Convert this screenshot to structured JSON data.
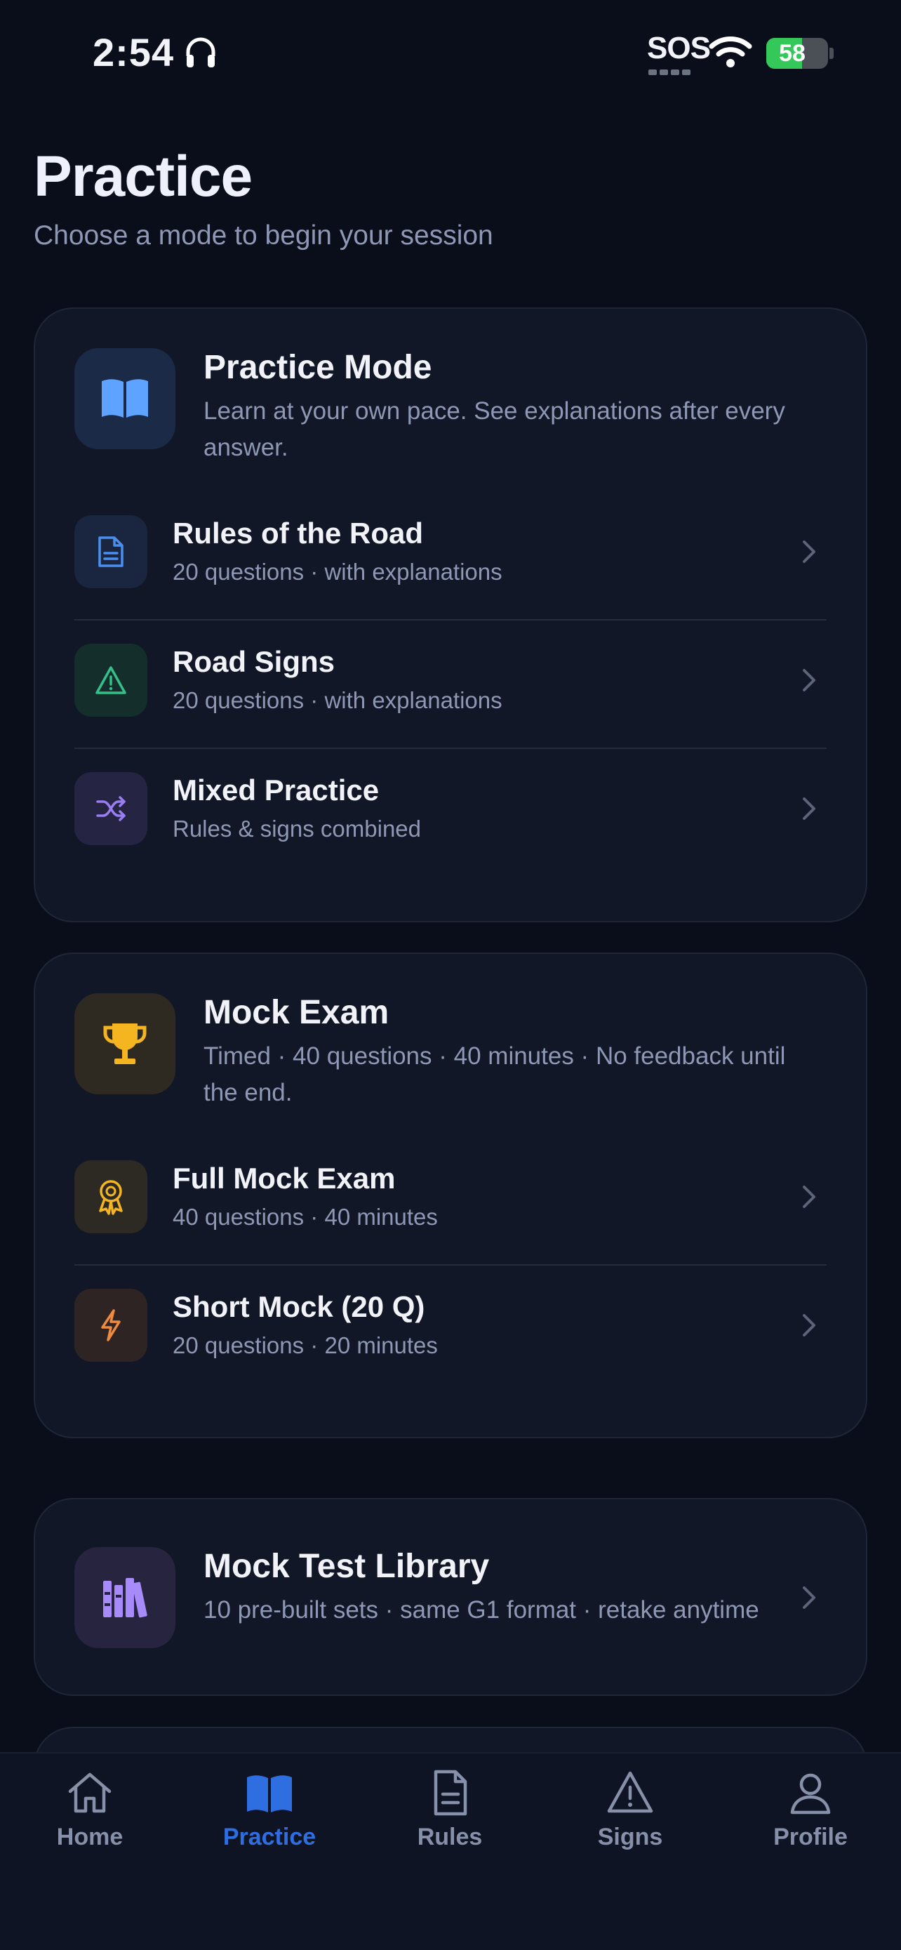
{
  "status": {
    "time": "2:54",
    "sos": "SOS",
    "battery": "58",
    "battery_level": 0.58
  },
  "header": {
    "title": "Practice",
    "subtitle": "Choose a mode to begin your session"
  },
  "practice_mode": {
    "title": "Practice Mode",
    "description": "Learn at your own pace. See explanations after every answer.",
    "icon": "open-book-icon",
    "items": [
      {
        "title": "Rules of the Road",
        "subtitle": "20 questions · with explanations",
        "icon": "document-icon",
        "accent": "#4a8ff0"
      },
      {
        "title": "Road Signs",
        "subtitle": "20 questions · with explanations",
        "icon": "warning-triangle-icon",
        "accent": "#34c08a"
      },
      {
        "title": "Mixed Practice",
        "subtitle": "Rules & signs combined",
        "icon": "shuffle-icon",
        "accent": "#9a7df0"
      }
    ]
  },
  "mock_exam": {
    "title": "Mock Exam",
    "description": "Timed · 40 questions · 40 minutes · No feedback until the end.",
    "icon": "trophy-icon",
    "items": [
      {
        "title": "Full Mock Exam",
        "subtitle": "40 questions · 40 minutes",
        "icon": "award-ribbon-icon",
        "accent": "#f5b521"
      },
      {
        "title": "Short Mock (20 Q)",
        "subtitle": "20 questions · 20 minutes",
        "icon": "lightning-icon",
        "accent": "#f08a3c"
      }
    ]
  },
  "library": {
    "title": "Mock Test Library",
    "description": "10 pre-built sets · same G1 format · retake anytime",
    "icon": "books-icon"
  },
  "tabs": [
    {
      "label": "Home",
      "icon": "home-icon",
      "active": false
    },
    {
      "label": "Practice",
      "icon": "open-book-icon",
      "active": true
    },
    {
      "label": "Rules",
      "icon": "document-icon",
      "active": false
    },
    {
      "label": "Signs",
      "icon": "warning-triangle-icon",
      "active": false
    },
    {
      "label": "Profile",
      "icon": "person-icon",
      "active": false
    }
  ],
  "colors": {
    "background": "#0a0e1a",
    "card": "#111726",
    "accent": "#2f6ee0",
    "muted": "#8e98b5"
  }
}
